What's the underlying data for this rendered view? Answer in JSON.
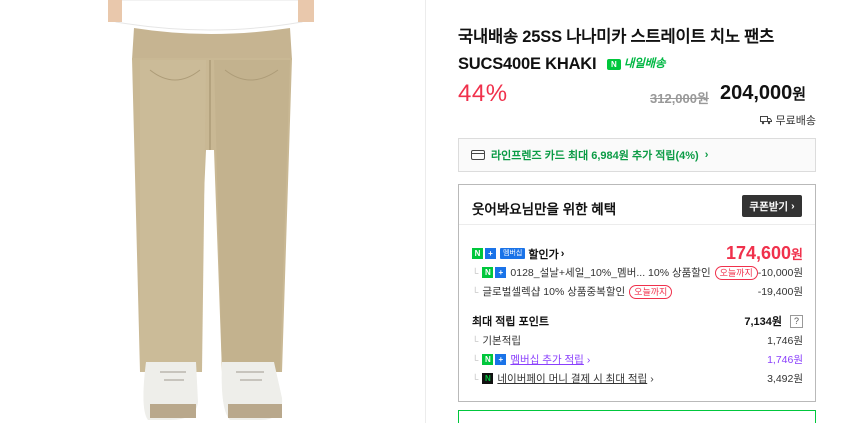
{
  "product": {
    "title": "국내배송 25SS 나나미카 스트레이트 치노 팬츠 SUCS400E KHAKI",
    "delivery_badge": "내일배송",
    "discount": "44%",
    "original_price": "312,000원",
    "sale_price": "204,000",
    "sale_price_unit": "원",
    "free_shipping": "무료배송"
  },
  "card_promo": {
    "text": "라인프렌즈 카드 최대 6,984원 추가 적립(4%)",
    "chevron": "›"
  },
  "benefits": {
    "title": "웃어봐요님만을 위한 혜택",
    "coupon_button": "쿠폰받기",
    "coupon_chevron": "›",
    "membership_tag": "멤버십",
    "discount_label": "할인가",
    "discount_chevron": "›",
    "discount_price": "174,600",
    "discount_price_unit": "원",
    "items": [
      {
        "label": "0128_설날+세일_10%_멤버... 10% 상품할인",
        "tag": "오늘까지",
        "value": "-10,000원"
      },
      {
        "label": "글로벌셀렉샵 10% 상품중복할인",
        "tag": "오늘까지",
        "value": "-19,400원"
      }
    ],
    "points_label": "최대 적립 포인트",
    "points_value": "7,134원",
    "points_help": "?",
    "point_items": [
      {
        "label": "기본적립",
        "value": "1,746원"
      },
      {
        "label": "멤버십 추가 적립",
        "value": "1,746원"
      },
      {
        "label": "네이버페이 머니 결제 시 최대 적립",
        "value": "3,492원"
      }
    ]
  },
  "colors": {
    "accent_red": "#f0314c",
    "naver_green": "#00c73c",
    "membership_purple": "#8a3ffc"
  }
}
